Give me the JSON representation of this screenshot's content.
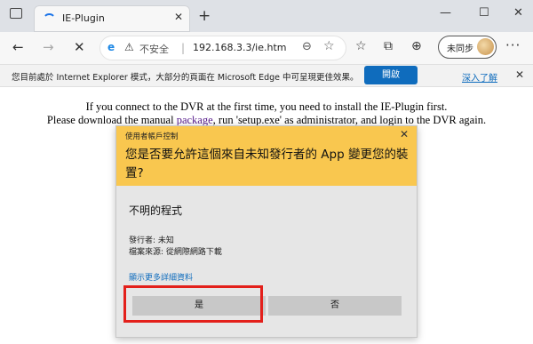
{
  "tab": {
    "title": "IE-Plugin",
    "close": "✕"
  },
  "window": {
    "minimize": "—",
    "maximize": "☐",
    "close": "✕",
    "new_tab": "+"
  },
  "address": {
    "warning_text": "不安全",
    "separator": "|",
    "url": "192.168.3.3/ie.htm"
  },
  "profile": {
    "label": "未同步"
  },
  "infobar": {
    "message": "您目前處於 Internet Explorer 模式，大部分的頁面在 Microsoft Edge 中可呈現更佳效果。",
    "open_button": "開啟",
    "learn_more": "深入了解",
    "close": "✕"
  },
  "page": {
    "line1": "If you connect to the DVR at the first time, you need to install the IE-Plugin first.",
    "line2_start": "Please download the manual ",
    "line2_link": "package",
    "line2_end": ", run 'setup.exe' as administrator, and login to the DVR again."
  },
  "uac": {
    "caption": "使用者帳戶控制",
    "close": "✕",
    "question": "您是否要允許這個來自未知發行者的 App 變更您的裝置?",
    "program": "不明的程式",
    "publisher": "發行者: 未知",
    "origin": "檔案來源: 從網際網路下載",
    "details_link": "顯示更多詳細資料",
    "yes_button": "是",
    "no_button": "否"
  },
  "colors": {
    "uac_header": "#f9c74f",
    "highlight": "#e3201b",
    "open_button": "#0f6cbd"
  }
}
